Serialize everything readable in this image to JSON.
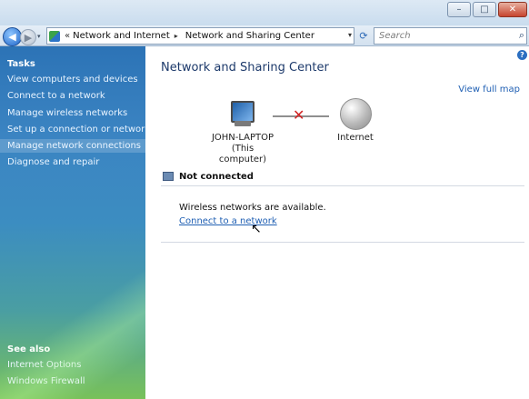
{
  "window": {
    "controls": {
      "minimize": "–",
      "maximize": "□",
      "close": "✕"
    }
  },
  "nav": {
    "back_glyph": "◀",
    "forward_glyph": "▶",
    "address": {
      "overflow_chevron": "«",
      "crumbs": [
        "Network and Internet",
        "Network and Sharing Center"
      ],
      "separator": "▸",
      "drop_glyph": "▾"
    },
    "refresh_glyph": "⟳",
    "search": {
      "placeholder": "Search",
      "icon": "search-icon"
    }
  },
  "sidebar": {
    "tasks_title": "Tasks",
    "items": [
      "View computers and devices",
      "Connect to a network",
      "Manage wireless networks",
      "Set up a connection or network",
      "Manage network connections",
      "Diagnose and repair"
    ],
    "see_also_title": "See also",
    "see_also": [
      "Internet Options",
      "Windows Firewall"
    ]
  },
  "main": {
    "title": "Network and Sharing Center",
    "view_full_map": "View full map",
    "computer_name": "JOHN-LAPTOP",
    "computer_sub": "(This computer)",
    "internet_label": "Internet",
    "broken_link_glyph": "✕",
    "status": "Not connected",
    "wireless_message": "Wireless networks are available.",
    "connect_link": "Connect to a network",
    "help_glyph": "?"
  },
  "colors": {
    "accent": "#1f5fb3",
    "error": "#d12424",
    "sidebar_top": "#2c73b6",
    "sidebar_bottom": "#78c15a"
  }
}
